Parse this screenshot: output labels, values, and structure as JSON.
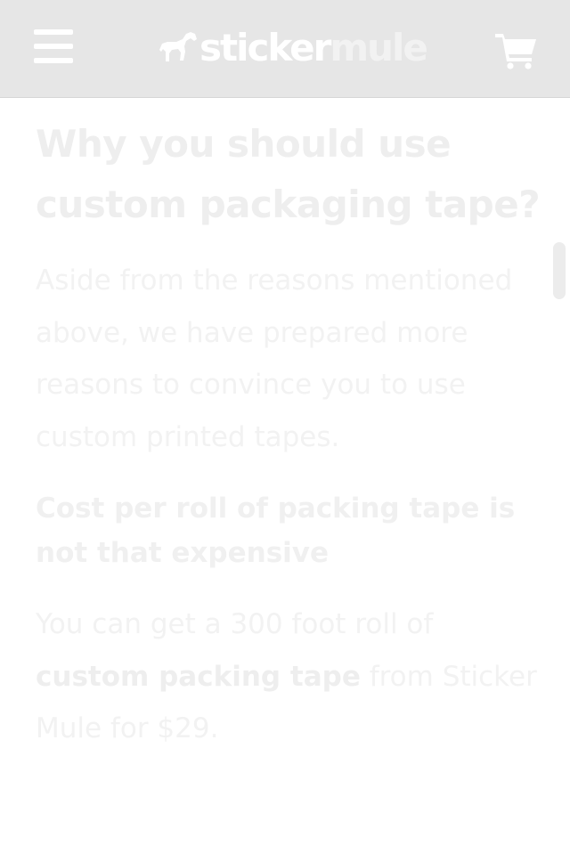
{
  "header": {
    "menu_icon": "hamburger-menu-icon",
    "logo": {
      "icon": "horse-icon",
      "word1": "sticker",
      "word2": "mule"
    },
    "cart_icon": "shopping-cart-icon"
  },
  "article": {
    "title": "Why you should use custom packaging tape?",
    "intro": "Aside from the reasons mentioned above, we have prepared more reasons to convince you to use custom printed tapes.",
    "section_heading": "Cost per roll of packing tape is not that expensive",
    "body": {
      "before_link": "You can get a 300 foot roll of ",
      "link_text": "custom packing tape",
      "after_link": " from Sticker Mule for $29."
    }
  },
  "colors": {
    "header_bg": "#e6e6e6",
    "header_icons": "#ffffff",
    "text": "#eeeeee",
    "page_bg": "#ffffff"
  }
}
